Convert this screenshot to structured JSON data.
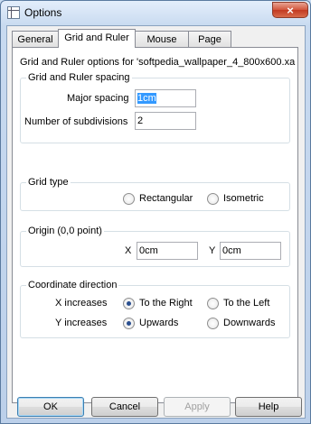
{
  "window": {
    "title": "Options",
    "close_label": "×"
  },
  "tabs": [
    {
      "label": "General",
      "active": false
    },
    {
      "label": "Grid and Ruler",
      "active": true
    },
    {
      "label": "Mouse",
      "active": false
    },
    {
      "label": "Page",
      "active": false
    }
  ],
  "panel": {
    "description": "Grid and Ruler options for 'softpedia_wallpaper_4_800x600.xa",
    "spacing": {
      "title": "Grid and Ruler spacing",
      "major_label": "Major spacing",
      "major_value": "1cm",
      "subdiv_label": "Number of subdivisions",
      "subdiv_value": "2"
    },
    "grid_type": {
      "title": "Grid type",
      "options": [
        {
          "label": "Rectangular",
          "selected": false
        },
        {
          "label": "Isometric",
          "selected": false
        }
      ]
    },
    "origin": {
      "title": "Origin (0,0 point)",
      "x_label": "X",
      "x_value": "0cm",
      "y_label": "Y",
      "y_value": "0cm"
    },
    "coordinate": {
      "title": "Coordinate direction",
      "x_label": "X increases",
      "x_options": [
        {
          "label": "To the Right",
          "selected": true
        },
        {
          "label": "To the Left",
          "selected": false
        }
      ],
      "y_label": "Y increases",
      "y_options": [
        {
          "label": "Upwards",
          "selected": true
        },
        {
          "label": "Downwards",
          "selected": false
        }
      ]
    }
  },
  "buttons": {
    "ok": "OK",
    "cancel": "Cancel",
    "apply": "Apply",
    "help": "Help"
  }
}
